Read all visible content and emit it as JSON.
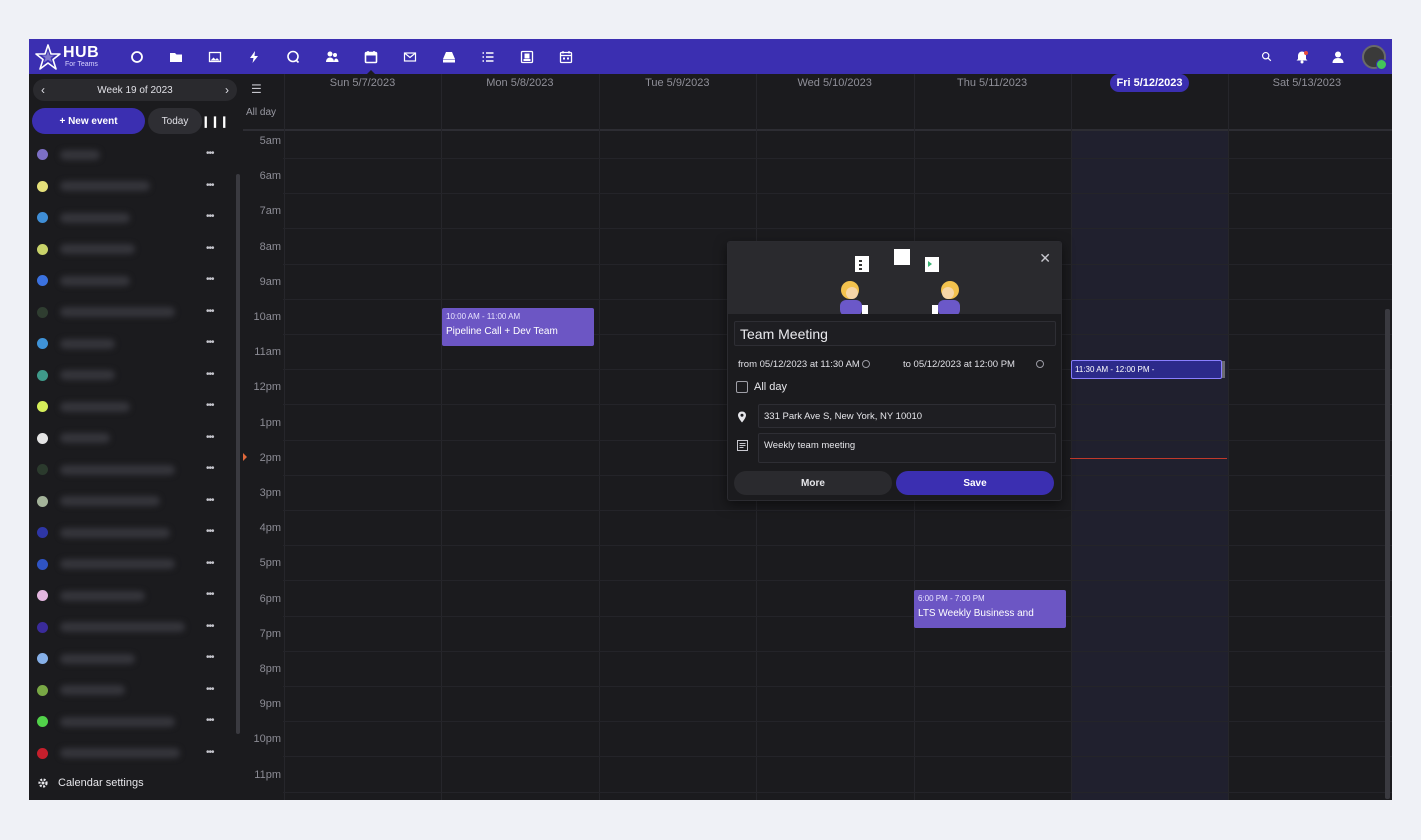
{
  "app": {
    "logo_text": "HUB",
    "logo_subtext": "For Teams"
  },
  "topbar": {
    "icons": [
      "circle-icon",
      "folder-icon",
      "image-icon",
      "bolt-icon",
      "chat-icon",
      "contacts-icon",
      "calendar-icon",
      "mail-icon",
      "drive-icon",
      "list-icon",
      "account-box-icon",
      "calendar-alt-icon"
    ],
    "active_icon": "calendar-icon",
    "right_icons": [
      "search-icon",
      "bell-icon",
      "user-icon"
    ],
    "brand_color": "#3b2fb1"
  },
  "sidebar": {
    "week_label": "Week 19 of 2023",
    "new_event_label": "+ New event",
    "today_label": "Today",
    "settings_label": "Calendar settings",
    "calendars": [
      {
        "color": "#7c6fc5"
      },
      {
        "color": "#e5e07a"
      },
      {
        "color": "#3f8ed6"
      },
      {
        "color": "#c9d36a"
      },
      {
        "color": "#3b72e0"
      },
      {
        "color": "#2f3d30"
      },
      {
        "color": "#3f93d8"
      },
      {
        "color": "#3f9a8a"
      },
      {
        "color": "#d6ef5a"
      },
      {
        "color": "#e5e5e5"
      },
      {
        "color": "#2b3a2d"
      },
      {
        "color": "#a4b39a"
      },
      {
        "color": "#2e36a6"
      },
      {
        "color": "#2f54c4"
      },
      {
        "color": "#e3b7e0"
      },
      {
        "color": "#3a2b9a"
      },
      {
        "color": "#86b0e8"
      },
      {
        "color": "#79a845"
      },
      {
        "color": "#52d24a"
      },
      {
        "color": "#c51f2c"
      }
    ]
  },
  "calendar": {
    "allday_label": "All day",
    "days": [
      {
        "label": "Sun 5/7/2023",
        "today": false
      },
      {
        "label": "Mon 5/8/2023",
        "today": false
      },
      {
        "label": "Tue 5/9/2023",
        "today": false
      },
      {
        "label": "Wed 5/10/2023",
        "today": false
      },
      {
        "label": "Thu 5/11/2023",
        "today": false
      },
      {
        "label": "Fri 5/12/2023",
        "today": true
      },
      {
        "label": "Sat 5/13/2023",
        "today": false
      }
    ],
    "hours": [
      "5am",
      "6am",
      "7am",
      "8am",
      "9am",
      "10am",
      "11am",
      "12pm",
      "1pm",
      "2pm",
      "3pm",
      "4pm",
      "5pm",
      "6pm",
      "7pm",
      "8pm",
      "9pm",
      "10pm",
      "11pm"
    ],
    "events": [
      {
        "time": "10:00 AM - 11:00 AM",
        "title": "Pipeline Call + Dev Team",
        "color": "#6c56c4"
      },
      {
        "time": "6:00 PM - 7:00 PM",
        "title": "LTS Weekly Business and",
        "color": "#6c56c4"
      }
    ],
    "draft_event_time": "11:30 AM - 12:00 PM -"
  },
  "popup": {
    "title": "Team Meeting",
    "from": "from 05/12/2023 at 11:30 AM",
    "to": "to 05/12/2023 at 12:00 PM",
    "allday_label": "All day",
    "location": "331 Park Ave S, New York, NY 10010",
    "notes": "Weekly team meeting",
    "more_label": "More",
    "save_label": "Save"
  }
}
